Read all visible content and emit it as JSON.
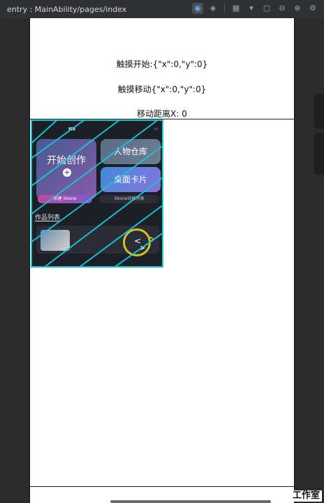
{
  "window": {
    "title": "entry : MainAbility/pages/index"
  },
  "toolbar": {
    "icons": [
      "eye-icon",
      "layers-icon",
      "grid-icon",
      "chevron-down-icon",
      "crop-icon",
      "zoom-out-icon",
      "zoom-in-icon",
      "settings-icon"
    ]
  },
  "page": {
    "touch_start": "触摸开始:{\"x\":0,\"y\":0}",
    "touch_move": "触摸移动{\"x\":0,\"y\":0}",
    "move_distance": "移动距离X: 0"
  },
  "preview": {
    "cards": {
      "create": "开始创作",
      "characters": "人物仓库",
      "desktop_card": "桌面卡片"
    },
    "pills": {
      "new": "新建 Xbone",
      "list": "Xbone动画列表"
    },
    "works_title": "作品列表"
  },
  "watermark": "工作室",
  "colors": {
    "accent_cyan": "#18c6d6",
    "ring_yellow": "#d4c21f"
  }
}
